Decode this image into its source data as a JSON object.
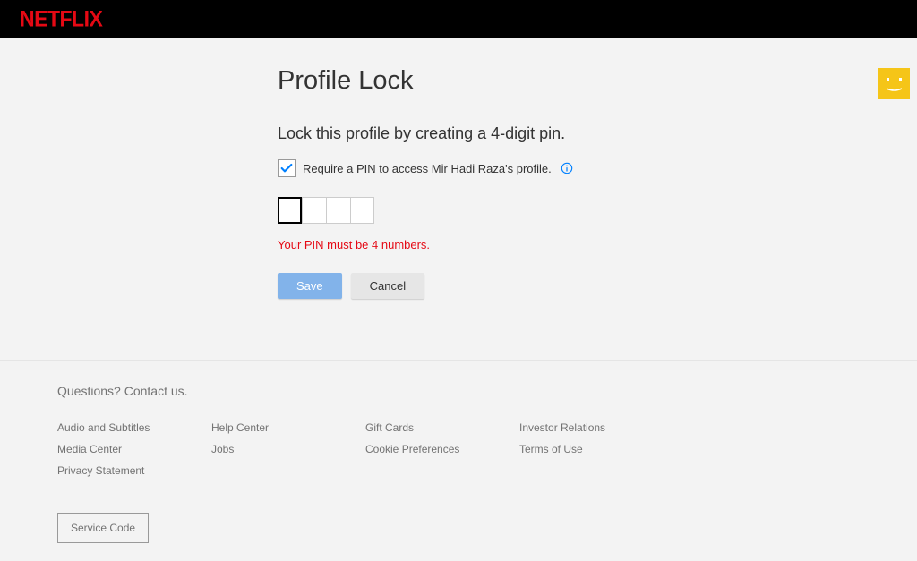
{
  "brand": "NETFLIX",
  "page": {
    "title": "Profile Lock",
    "instruction": "Lock this profile by creating a 4-digit pin.",
    "checkbox_label": "Require a PIN to access Mir Hadi Raza's profile.",
    "error": "Your PIN must be 4 numbers."
  },
  "buttons": {
    "save": "Save",
    "cancel": "Cancel"
  },
  "footer": {
    "heading": "Questions? Contact us.",
    "links": {
      "audio": "Audio and Subtitles",
      "help": "Help Center",
      "gift": "Gift Cards",
      "investor": "Investor Relations",
      "media": "Media Center",
      "jobs": "Jobs",
      "cookie": "Cookie Preferences",
      "terms": "Terms of Use",
      "privacy": "Privacy Statement"
    },
    "service_code": "Service Code"
  }
}
